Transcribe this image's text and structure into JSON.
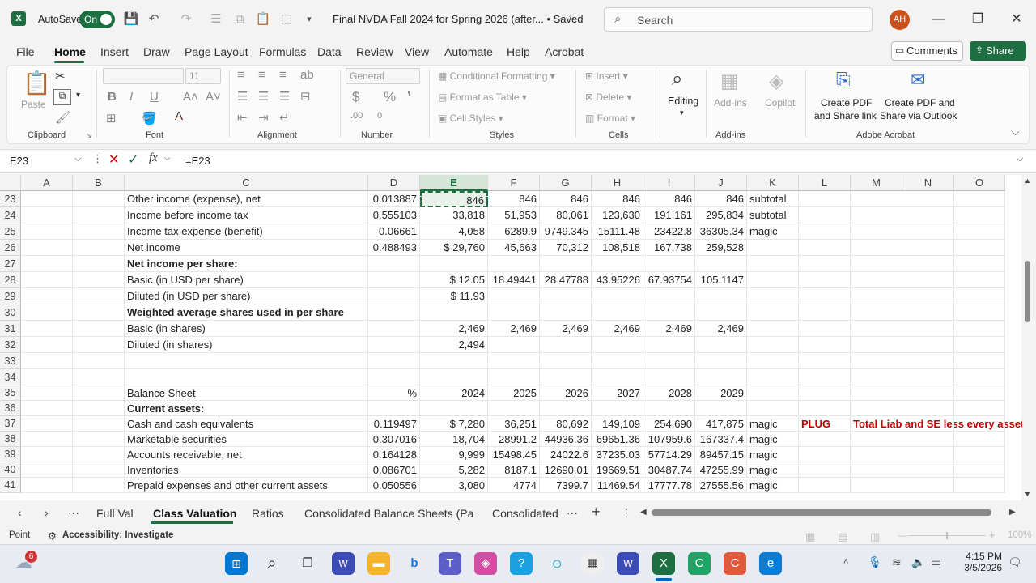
{
  "titlebar": {
    "autosave_label": "AutoSave",
    "autosave_state": "On",
    "doc_title": "Final NVDA Fall 2024 for Spring 2026 (after... • Saved",
    "search_placeholder": "Search",
    "avatar_initials": "AH"
  },
  "menu": {
    "items": [
      "File",
      "Home",
      "Insert",
      "Draw",
      "Page Layout",
      "Formulas",
      "Data",
      "Review",
      "View",
      "Automate",
      "Help",
      "Acrobat"
    ],
    "active": "Home",
    "comments_label": "Comments",
    "share_label": "Share"
  },
  "ribbon": {
    "clipboard": {
      "paste": "Paste",
      "label": "Clipboard"
    },
    "font": {
      "size": "11",
      "label": "Font"
    },
    "alignment": {
      "label": "Alignment"
    },
    "number": {
      "format": "General",
      "label": "Number"
    },
    "styles": {
      "conditional": "Conditional Formatting",
      "table": "Format as Table",
      "cell_styles": "Cell Styles",
      "label": "Styles"
    },
    "cells": {
      "insert": "Insert",
      "delete": "Delete",
      "format": "Format",
      "label": "Cells"
    },
    "editing": {
      "label": "Editing"
    },
    "addins": {
      "addins": "Add-ins",
      "copilot": "Copilot",
      "label": "Add-ins"
    },
    "acrobat": {
      "pdf_link_1": "Create PDF",
      "pdf_link_2": "and Share link",
      "pdf_outlook_1": "Create PDF and",
      "pdf_outlook_2": "Share via Outlook",
      "label": "Adobe Acrobat"
    }
  },
  "formula_bar": {
    "name_box": "E23",
    "formula": "=E23"
  },
  "columns": [
    "A",
    "B",
    "C",
    "D",
    "E",
    "F",
    "G",
    "H",
    "I",
    "J",
    "K",
    "L",
    "M",
    "N",
    "O"
  ],
  "rows": [
    {
      "n": "23",
      "C": "Other income (expense), net",
      "D": "0.013887",
      "E": "846",
      "F": "846",
      "G": "846",
      "H": "846",
      "I": "846",
      "J": "846",
      "K": "subtotal"
    },
    {
      "n": "24",
      "C": "Income before income tax",
      "D": "0.555103",
      "E": "33,818",
      "F": "51,953",
      "G": "80,061",
      "H": "123,630",
      "I": "191,161",
      "J": "295,834",
      "K": "subtotal"
    },
    {
      "n": "25",
      "C": "Income tax expense (benefit)",
      "D": "0.06661",
      "E": "4,058",
      "F": "6289.9",
      "G": "9749.345",
      "H": "15111.48",
      "I": "23422.8",
      "J": "36305.34",
      "K": "magic"
    },
    {
      "n": "26",
      "C": "Net income",
      "D": "0.488493",
      "E": "$ 29,760",
      "F": "45,663",
      "G": "70,312",
      "H": "108,518",
      "I": "167,738",
      "J": "259,528"
    },
    {
      "n": "27",
      "C": "Net income per share:",
      "bold": true
    },
    {
      "n": "28",
      "C": "Basic (in USD per share)",
      "E": "$ 12.05",
      "F": "18.49441",
      "G": "28.47788",
      "H": "43.95226",
      "I": "67.93754",
      "J": "105.1147"
    },
    {
      "n": "29",
      "C": "Diluted (in USD per share)",
      "E": "$ 11.93"
    },
    {
      "n": "30",
      "C": "Weighted average shares used in per share",
      "bold": true
    },
    {
      "n": "31",
      "C": "Basic (in shares)",
      "E": "2,469",
      "F": "2,469",
      "G": "2,469",
      "H": "2,469",
      "I": "2,469",
      "J": "2,469"
    },
    {
      "n": "32",
      "C": "Diluted (in shares)",
      "E": "2,494"
    },
    {
      "n": "33"
    },
    {
      "n": "34"
    },
    {
      "n": "35",
      "C": "Balance Sheet",
      "D": "%",
      "E": "2024",
      "F": "2025",
      "G": "2026",
      "H": "2027",
      "I": "2028",
      "J": "2029"
    },
    {
      "n": "36",
      "C": "Current assets:",
      "bold": true
    },
    {
      "n": "37",
      "C": "Cash and cash equivalents",
      "D": "0.119497",
      "E": "$ 7,280",
      "F": "36,251",
      "G": "80,692",
      "H": "149,109",
      "I": "254,690",
      "J": "417,875",
      "K": "magic",
      "L": "PLUG",
      "M": "Total Liab and SE less every asset t"
    },
    {
      "n": "38",
      "C": "Marketable securities",
      "D": "0.307016",
      "E": "18,704",
      "F": "28991.2",
      "G": "44936.36",
      "H": "69651.36",
      "I": "107959.6",
      "J": "167337.4",
      "K": "magic"
    },
    {
      "n": "39",
      "C": "Accounts receivable, net",
      "D": "0.164128",
      "E": "9,999",
      "F": "15498.45",
      "G": "24022.6",
      "H": "37235.03",
      "I": "57714.29",
      "J": "89457.15",
      "K": "magic"
    },
    {
      "n": "40",
      "C": "Inventories",
      "D": "0.086701",
      "E": "5,282",
      "F": "8187.1",
      "G": "12690.01",
      "H": "19669.51",
      "I": "30487.74",
      "J": "47255.99",
      "K": "magic"
    },
    {
      "n": "41",
      "C": "Prepaid expenses and other current assets",
      "D": "0.050556",
      "E": "3,080",
      "F": "4774",
      "G": "7399.7",
      "H": "11469.54",
      "I": "17777.78",
      "J": "27555.56",
      "K": "magic"
    }
  ],
  "sheet_tabs": [
    "Full Val",
    "Class Valuation",
    "Ratios",
    "Consolidated Balance Sheets (Pa",
    "Consolidated"
  ],
  "active_tab": "Class Valuation",
  "status": {
    "mode": "Point",
    "accessibility": "Accessibility: Investigate",
    "zoom": "100%"
  },
  "taskbar": {
    "time": "4:15 PM",
    "date": "3/5/2026",
    "weather_badge": "6"
  },
  "colors": {
    "accent": "#1d6f42",
    "plug_red": "#c00000"
  }
}
